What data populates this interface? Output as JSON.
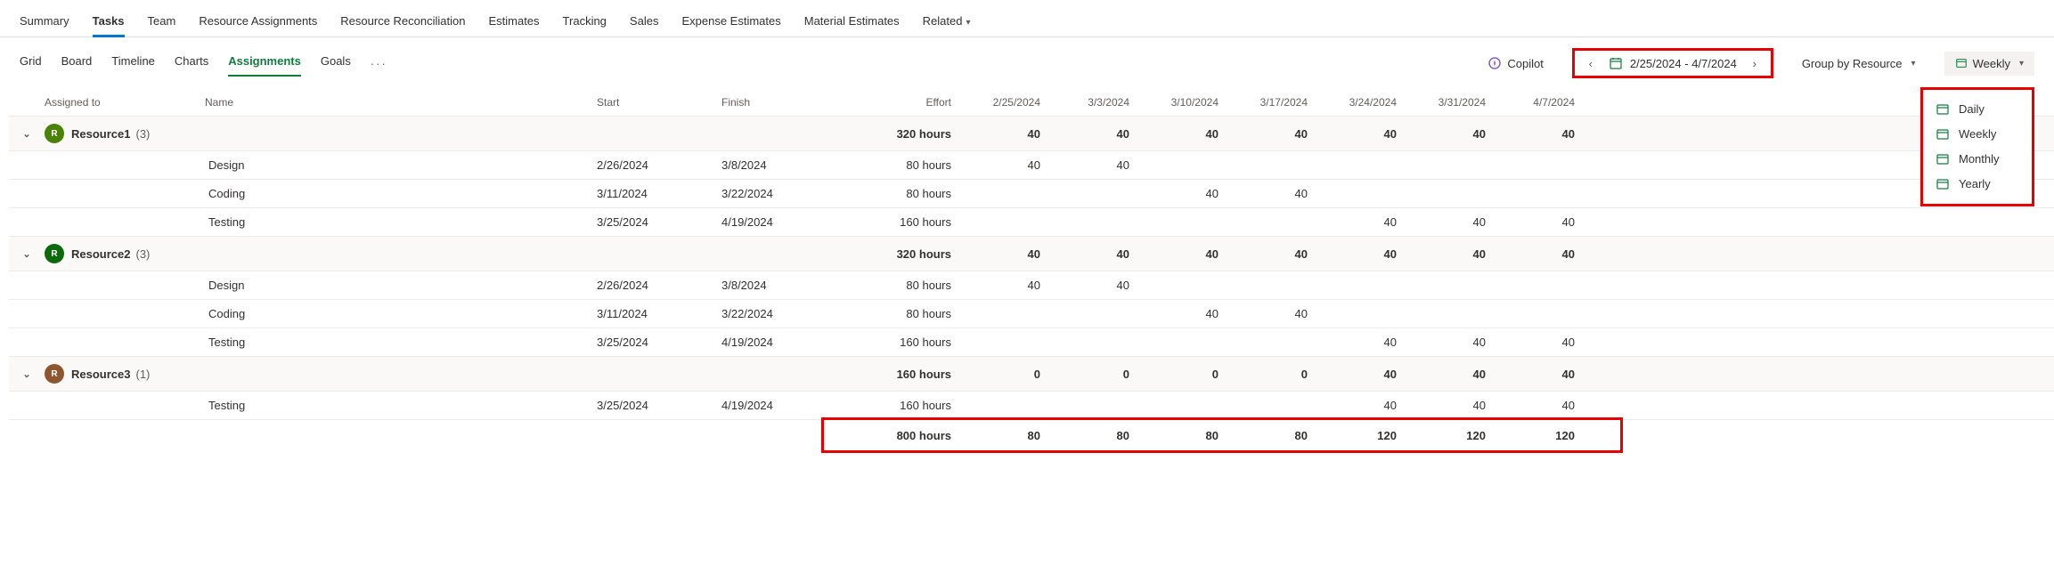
{
  "topTabs": {
    "items": [
      "Summary",
      "Tasks",
      "Team",
      "Resource Assignments",
      "Resource Reconciliation",
      "Estimates",
      "Tracking",
      "Sales",
      "Expense Estimates",
      "Material Estimates",
      "Related"
    ],
    "activeIndex": 1,
    "relatedHasChevron": true
  },
  "subTabs": {
    "items": [
      "Grid",
      "Board",
      "Timeline",
      "Charts",
      "Assignments",
      "Goals"
    ],
    "activeIndex": 4
  },
  "toolbar": {
    "copilot": "Copilot",
    "dateRange": "2/25/2024 - 4/7/2024",
    "groupBy": "Group by Resource",
    "timescale": "Weekly"
  },
  "timescaleDropdown": [
    "Daily",
    "Weekly",
    "Monthly",
    "Yearly"
  ],
  "columns": {
    "assignedTo": "Assigned to",
    "name": "Name",
    "start": "Start",
    "finish": "Finish",
    "effort": "Effort",
    "dates": [
      "2/25/2024",
      "3/3/2024",
      "3/10/2024",
      "3/17/2024",
      "3/24/2024",
      "3/31/2024",
      "4/7/2024"
    ]
  },
  "groups": [
    {
      "resource": "Resource1",
      "count": "(3)",
      "avatar": "R",
      "avatarClass": "av-teal",
      "effort": "320 hours",
      "cells": [
        "40",
        "40",
        "40",
        "40",
        "40",
        "40",
        "40"
      ],
      "tasks": [
        {
          "name": "Design",
          "start": "2/26/2024",
          "finish": "3/8/2024",
          "effort": "80 hours",
          "cells": [
            "40",
            "40",
            "",
            "",
            "",
            "",
            ""
          ]
        },
        {
          "name": "Coding",
          "start": "3/11/2024",
          "finish": "3/22/2024",
          "effort": "80 hours",
          "cells": [
            "",
            "",
            "40",
            "40",
            "",
            "",
            ""
          ]
        },
        {
          "name": "Testing",
          "start": "3/25/2024",
          "finish": "4/19/2024",
          "effort": "160 hours",
          "cells": [
            "",
            "",
            "",
            "",
            "40",
            "40",
            "40"
          ]
        }
      ]
    },
    {
      "resource": "Resource2",
      "count": "(3)",
      "avatar": "R",
      "avatarClass": "av-green",
      "effort": "320 hours",
      "cells": [
        "40",
        "40",
        "40",
        "40",
        "40",
        "40",
        "40"
      ],
      "tasks": [
        {
          "name": "Design",
          "start": "2/26/2024",
          "finish": "3/8/2024",
          "effort": "80 hours",
          "cells": [
            "40",
            "40",
            "",
            "",
            "",
            "",
            ""
          ]
        },
        {
          "name": "Coding",
          "start": "3/11/2024",
          "finish": "3/22/2024",
          "effort": "80 hours",
          "cells": [
            "",
            "",
            "40",
            "40",
            "",
            "",
            ""
          ]
        },
        {
          "name": "Testing",
          "start": "3/25/2024",
          "finish": "4/19/2024",
          "effort": "160 hours",
          "cells": [
            "",
            "",
            "",
            "",
            "40",
            "40",
            "40"
          ]
        }
      ]
    },
    {
      "resource": "Resource3",
      "count": "(1)",
      "avatar": "R",
      "avatarClass": "av-brown",
      "effort": "160 hours",
      "cells": [
        "0",
        "0",
        "0",
        "0",
        "40",
        "40",
        "40"
      ],
      "tasks": [
        {
          "name": "Testing",
          "start": "3/25/2024",
          "finish": "4/19/2024",
          "effort": "160 hours",
          "cells": [
            "",
            "",
            "",
            "",
            "40",
            "40",
            "40"
          ]
        }
      ]
    }
  ],
  "totals": {
    "effort": "800 hours",
    "cells": [
      "80",
      "80",
      "80",
      "80",
      "120",
      "120",
      "120"
    ]
  }
}
